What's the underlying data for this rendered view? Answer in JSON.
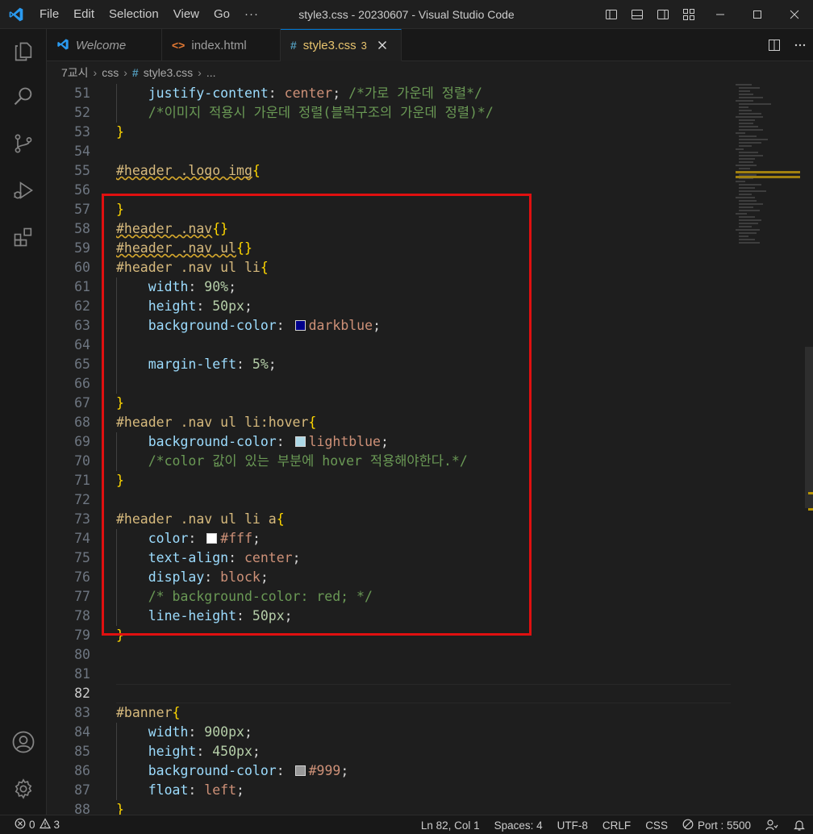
{
  "window": {
    "title": "style3.css - 20230607 - Visual Studio Code",
    "menu": [
      "File",
      "Edit",
      "Selection",
      "View",
      "Go",
      "···"
    ]
  },
  "tabs": [
    {
      "label": "Welcome",
      "icon": "vscode-icon",
      "active": false
    },
    {
      "label": "index.html",
      "icon": "html-icon",
      "icon_glyph": "<>",
      "active": false
    },
    {
      "label": "style3.css",
      "icon": "css-icon",
      "icon_glyph": "#",
      "badge": "3",
      "active": true
    }
  ],
  "breadcrumb": [
    "7교시",
    "css",
    "style3.css",
    "..."
  ],
  "editor": {
    "current_line": "82",
    "lines": [
      {
        "n": "51",
        "indent": 1,
        "tokens": [
          [
            "prop",
            "justify-content"
          ],
          [
            "punc",
            ": "
          ],
          [
            "val",
            "center"
          ],
          [
            "punc",
            "; "
          ],
          [
            "com",
            "/*가로 가운데 정렬*/"
          ]
        ]
      },
      {
        "n": "52",
        "indent": 1,
        "tokens": [
          [
            "com",
            "/*이미지 적용시 가운데 정렬(블럭구조의 가운데 정렬)*/"
          ]
        ]
      },
      {
        "n": "53",
        "indent": 0,
        "tokens": [
          [
            "brace",
            "}"
          ]
        ]
      },
      {
        "n": "54",
        "indent": 0,
        "tokens": []
      },
      {
        "n": "55",
        "indent": 0,
        "tokens": [
          [
            "selsq",
            "#header .logo img"
          ],
          [
            "brace",
            "{"
          ]
        ]
      },
      {
        "n": "56",
        "indent": 0,
        "tokens": []
      },
      {
        "n": "57",
        "indent": 0,
        "tokens": [
          [
            "brace",
            "}"
          ]
        ]
      },
      {
        "n": "58",
        "indent": 0,
        "tokens": [
          [
            "selsq",
            "#header .nav"
          ],
          [
            "brace",
            "{}"
          ]
        ]
      },
      {
        "n": "59",
        "indent": 0,
        "tokens": [
          [
            "selsq",
            "#header .nav ul"
          ],
          [
            "brace",
            "{}"
          ]
        ]
      },
      {
        "n": "60",
        "indent": 0,
        "tokens": [
          [
            "sel",
            "#header .nav ul li"
          ],
          [
            "brace",
            "{"
          ]
        ]
      },
      {
        "n": "61",
        "indent": 1,
        "tokens": [
          [
            "prop",
            "width"
          ],
          [
            "punc",
            ": "
          ],
          [
            "num",
            "90%"
          ],
          [
            "punc",
            ";"
          ]
        ]
      },
      {
        "n": "62",
        "indent": 1,
        "tokens": [
          [
            "prop",
            "height"
          ],
          [
            "punc",
            ": "
          ],
          [
            "num",
            "50px"
          ],
          [
            "punc",
            ";"
          ]
        ]
      },
      {
        "n": "63",
        "indent": 1,
        "tokens": [
          [
            "prop",
            "background-color"
          ],
          [
            "punc",
            ": "
          ],
          [
            "swatch",
            "#00008b"
          ],
          [
            "val",
            "darkblue"
          ],
          [
            "punc",
            ";"
          ]
        ]
      },
      {
        "n": "64",
        "indent": 1,
        "tokens": []
      },
      {
        "n": "65",
        "indent": 1,
        "tokens": [
          [
            "prop",
            "margin-left"
          ],
          [
            "punc",
            ": "
          ],
          [
            "num",
            "5%"
          ],
          [
            "punc",
            ";"
          ]
        ]
      },
      {
        "n": "66",
        "indent": 1,
        "tokens": []
      },
      {
        "n": "67",
        "indent": 0,
        "tokens": [
          [
            "brace",
            "}"
          ]
        ]
      },
      {
        "n": "68",
        "indent": 0,
        "tokens": [
          [
            "sel",
            "#header .nav ul li:hover"
          ],
          [
            "brace",
            "{"
          ]
        ]
      },
      {
        "n": "69",
        "indent": 1,
        "tokens": [
          [
            "prop",
            "background-color"
          ],
          [
            "punc",
            ": "
          ],
          [
            "swatch",
            "#add8e6"
          ],
          [
            "val",
            "lightblue"
          ],
          [
            "punc",
            ";"
          ]
        ]
      },
      {
        "n": "70",
        "indent": 1,
        "tokens": [
          [
            "com",
            "/*color 값이 있는 부분에 hover 적용해야한다.*/"
          ]
        ]
      },
      {
        "n": "71",
        "indent": 0,
        "tokens": [
          [
            "brace",
            "}"
          ]
        ]
      },
      {
        "n": "72",
        "indent": 0,
        "tokens": []
      },
      {
        "n": "73",
        "indent": 0,
        "tokens": [
          [
            "sel",
            "#header .nav ul li a"
          ],
          [
            "brace",
            "{"
          ]
        ]
      },
      {
        "n": "74",
        "indent": 1,
        "tokens": [
          [
            "prop",
            "color"
          ],
          [
            "punc",
            ": "
          ],
          [
            "swatch",
            "#ffffff"
          ],
          [
            "val",
            "#fff"
          ],
          [
            "punc",
            ";"
          ]
        ]
      },
      {
        "n": "75",
        "indent": 1,
        "tokens": [
          [
            "prop",
            "text-align"
          ],
          [
            "punc",
            ": "
          ],
          [
            "val",
            "center"
          ],
          [
            "punc",
            ";"
          ]
        ]
      },
      {
        "n": "76",
        "indent": 1,
        "tokens": [
          [
            "prop",
            "display"
          ],
          [
            "punc",
            ": "
          ],
          [
            "val",
            "block"
          ],
          [
            "punc",
            ";"
          ]
        ]
      },
      {
        "n": "77",
        "indent": 1,
        "tokens": [
          [
            "com",
            "/* background-color: red; */"
          ]
        ]
      },
      {
        "n": "78",
        "indent": 1,
        "tokens": [
          [
            "prop",
            "line-height"
          ],
          [
            "punc",
            ": "
          ],
          [
            "num",
            "50px"
          ],
          [
            "punc",
            ";"
          ]
        ]
      },
      {
        "n": "79",
        "indent": 0,
        "tokens": [
          [
            "brace",
            "}"
          ]
        ]
      },
      {
        "n": "80",
        "indent": 0,
        "tokens": []
      },
      {
        "n": "81",
        "indent": 0,
        "tokens": []
      },
      {
        "n": "82",
        "indent": 0,
        "tokens": []
      },
      {
        "n": "83",
        "indent": 0,
        "tokens": [
          [
            "sel",
            "#banner"
          ],
          [
            "brace",
            "{"
          ]
        ]
      },
      {
        "n": "84",
        "indent": 1,
        "tokens": [
          [
            "prop",
            "width"
          ],
          [
            "punc",
            ": "
          ],
          [
            "num",
            "900px"
          ],
          [
            "punc",
            ";"
          ]
        ]
      },
      {
        "n": "85",
        "indent": 1,
        "tokens": [
          [
            "prop",
            "height"
          ],
          [
            "punc",
            ": "
          ],
          [
            "num",
            "450px"
          ],
          [
            "punc",
            ";"
          ]
        ]
      },
      {
        "n": "86",
        "indent": 1,
        "tokens": [
          [
            "prop",
            "background-color"
          ],
          [
            "punc",
            ": "
          ],
          [
            "swatch",
            "#999999"
          ],
          [
            "val",
            "#999"
          ],
          [
            "punc",
            ";"
          ]
        ]
      },
      {
        "n": "87",
        "indent": 1,
        "tokens": [
          [
            "prop",
            "float"
          ],
          [
            "punc",
            ": "
          ],
          [
            "val",
            "left"
          ],
          [
            "punc",
            ";"
          ]
        ]
      },
      {
        "n": "88",
        "indent": 0,
        "tokens": [
          [
            "brace",
            "}"
          ]
        ]
      }
    ]
  },
  "status": {
    "errors": "0",
    "warnings": "3",
    "position": "Ln 82, Col 1",
    "spaces": "Spaces: 4",
    "encoding": "UTF-8",
    "eol": "CRLF",
    "language": "CSS",
    "port": "Port : 5500"
  },
  "colors": {
    "accent": "#0078d4",
    "highlight_box": "#e01010"
  }
}
